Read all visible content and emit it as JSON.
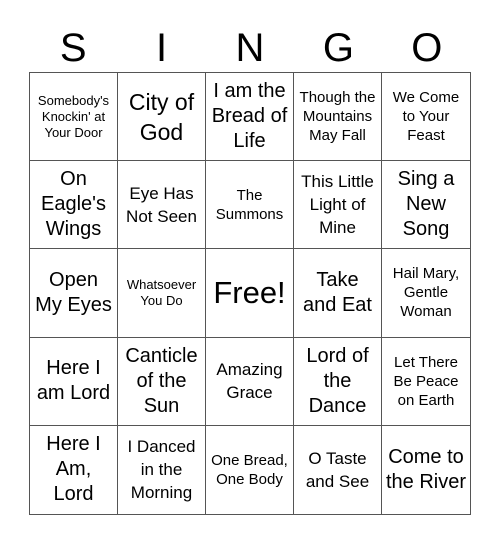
{
  "title_letters": [
    "S",
    "I",
    "N",
    "G",
    "O"
  ],
  "board": {
    "cells": [
      "Somebody's Knockin' at Your Door",
      "City of God",
      "I am the Bread of Life",
      "Though the Mountains May Fall",
      "We Come to Your Feast",
      "On Eagle's Wings",
      "Eye Has Not Seen",
      "The Summons",
      "This Little Light of Mine",
      "Sing a New Song",
      "Open My Eyes",
      "Whatsoever You Do",
      "Free!",
      "Take and Eat",
      "Hail Mary, Gentle Woman",
      "Here I am Lord",
      "Canticle of the Sun",
      "Amazing Grace",
      "Lord of the Dance",
      "Let There Be Peace on Earth",
      "Here I Am, Lord",
      "I Danced in the Morning",
      "One Bread, One Body",
      "O Taste and See",
      "Come to the River"
    ],
    "free_space_index": 12
  },
  "colors": {
    "background": "#ffffff",
    "text": "#000000",
    "grid_line": "#555555"
  }
}
